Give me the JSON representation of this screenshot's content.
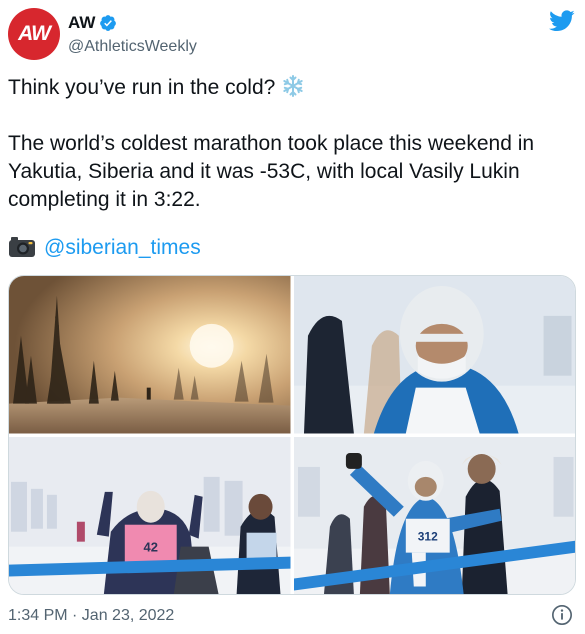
{
  "header": {
    "avatar_text": "AW",
    "display_name": "AW",
    "handle": "@AthleticsWeekly",
    "brand_color": "#d7272e",
    "verified_color": "#1d9bf0"
  },
  "tweet": {
    "line1": "Think you’ve run in the cold?",
    "line2": "The world’s coldest marathon took place this weekend in Yakutia, Siberia and it was -53C, with local Vasily Lukin completing it in 3:22.",
    "credit_link": "@siberian_times",
    "icons": [
      "snowflake-icon",
      "camera-icon"
    ]
  },
  "media": {
    "photos": [
      {
        "name": "photo-forest-sunrise"
      },
      {
        "name": "photo-frozen-runner-closeup"
      },
      {
        "name": "photo-finish-line-runner-42",
        "bib": "42"
      },
      {
        "name": "photo-finish-line-runner-312",
        "bib": "312"
      }
    ]
  },
  "footer": {
    "timestamp": "1:34 PM · Jan 23, 2022",
    "info_icon": "info-icon"
  }
}
